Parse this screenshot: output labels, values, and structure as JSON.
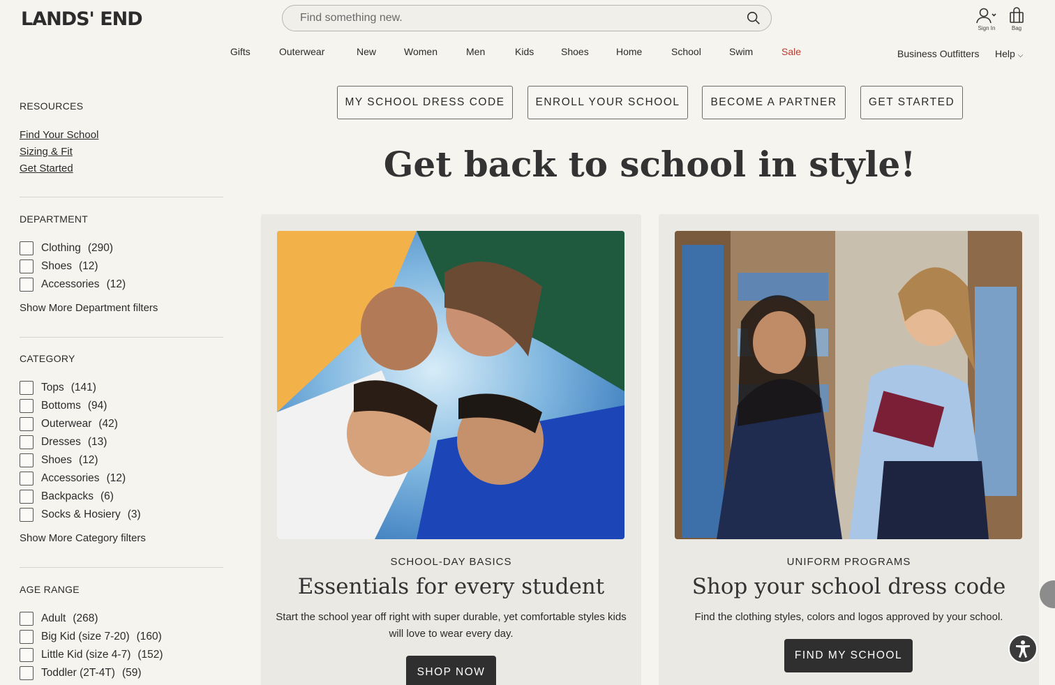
{
  "brand": {
    "logo": "LANDS' END"
  },
  "search": {
    "placeholder": "Find something new."
  },
  "account": {
    "sign_in": "Sign In",
    "bag": "Bag"
  },
  "nav": {
    "items": [
      "Gifts",
      "Outerwear",
      "New",
      "Women",
      "Men",
      "Kids",
      "Shoes",
      "Home",
      "School",
      "Swim",
      "Sale"
    ],
    "business": "Business Outfitters",
    "help": "Help"
  },
  "sidebar": {
    "resources": {
      "title": "RESOURCES",
      "links": [
        "Find Your School",
        "Sizing & Fit",
        "Get Started"
      ]
    },
    "department": {
      "title": "DEPARTMENT",
      "items": [
        {
          "label": "Clothing",
          "count": "(290)"
        },
        {
          "label": "Shoes",
          "count": "(12)"
        },
        {
          "label": "Accessories",
          "count": "(12)"
        }
      ],
      "show_more": "Show More Department filters"
    },
    "category": {
      "title": "CATEGORY",
      "items": [
        {
          "label": "Tops",
          "count": "(141)"
        },
        {
          "label": "Bottoms",
          "count": "(94)"
        },
        {
          "label": "Outerwear",
          "count": "(42)"
        },
        {
          "label": "Dresses",
          "count": "(13)"
        },
        {
          "label": "Shoes",
          "count": "(12)"
        },
        {
          "label": "Accessories",
          "count": "(12)"
        },
        {
          "label": "Backpacks",
          "count": "(6)"
        },
        {
          "label": "Socks & Hosiery",
          "count": "(3)"
        }
      ],
      "show_more": "Show More Category filters"
    },
    "age_range": {
      "title": "AGE RANGE",
      "items": [
        {
          "label": "Adult",
          "count": "(268)"
        },
        {
          "label": "Big Kid (size 7-20)",
          "count": "(160)"
        },
        {
          "label": "Little Kid (size 4-7)",
          "count": "(152)"
        },
        {
          "label": "Toddler (2T-4T)",
          "count": "(59)"
        }
      ]
    }
  },
  "actions": [
    "MY SCHOOL DRESS CODE",
    "ENROLL YOUR SCHOOL",
    "BECOME A PARTNER",
    "GET STARTED"
  ],
  "hero": {
    "title": "Get back to school in style!"
  },
  "cards": [
    {
      "kicker": "SCHOOL-DAY BASICS",
      "title": "Essentials for every student",
      "description": "Start the school year off right with super durable, yet comfortable styles kids will love to wear every day.",
      "button": "SHOP NOW"
    },
    {
      "kicker": "UNIFORM PROGRAMS",
      "title": "Shop your school dress code",
      "description": "Find the clothing styles, colors and logos approved by your school.",
      "button": "FIND MY SCHOOL"
    }
  ],
  "colors": {
    "sale": "#c0392b",
    "dark_button": "#2f2f2f",
    "background": "#f6f4ef"
  }
}
